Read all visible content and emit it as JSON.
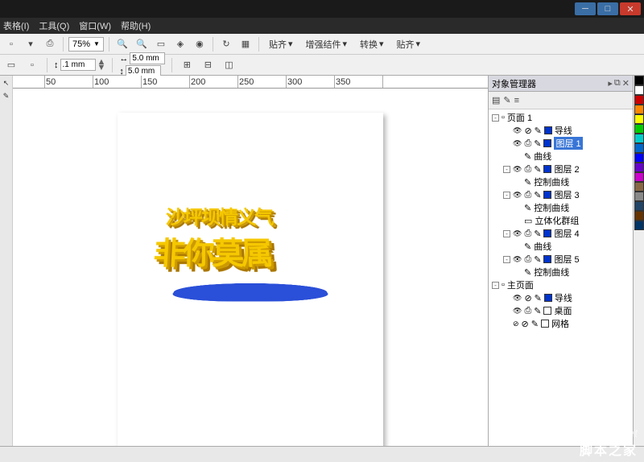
{
  "menubar": [
    "表格(I)",
    "工具(Q)",
    "窗口(W)",
    "帮助(H)"
  ],
  "toolbar1": {
    "zoom": "75%",
    "actions": [
      "贴齐",
      "增强结件",
      "转换",
      "贴齐"
    ]
  },
  "toolbar2": {
    "nudge": ".1 mm",
    "w": "5.0 mm",
    "h": "5.0 mm"
  },
  "ruler_ticks": [
    "50",
    "100",
    "150",
    "200",
    "250",
    "300",
    "350"
  ],
  "artwork": {
    "line1": "沙坪坝情义气",
    "line2": "非你莫属"
  },
  "panel": {
    "title": "对象管理器",
    "tree": [
      {
        "lvl": 1,
        "exp": "-",
        "label": "页面 1",
        "icon": "page"
      },
      {
        "lvl": 2,
        "exp": "",
        "label": "导线",
        "vis": true,
        "prn": false,
        "sw": "blue"
      },
      {
        "lvl": 2,
        "exp": "",
        "label": "图层 1",
        "vis": true,
        "prn": true,
        "sw": "blue",
        "sel": true
      },
      {
        "lvl": 3,
        "exp": "",
        "label": "曲线",
        "icon": "curve"
      },
      {
        "lvl": 2,
        "exp": "-",
        "label": "图层 2",
        "vis": true,
        "prn": true,
        "sw": "blue"
      },
      {
        "lvl": 3,
        "exp": "",
        "label": "控制曲线",
        "icon": "curve"
      },
      {
        "lvl": 2,
        "exp": "-",
        "label": "图层 3",
        "vis": true,
        "prn": true,
        "sw": "blue"
      },
      {
        "lvl": 3,
        "exp": "",
        "label": "控制曲线",
        "icon": "curve"
      },
      {
        "lvl": 3,
        "exp": "",
        "label": "立体化群组",
        "icon": "group"
      },
      {
        "lvl": 2,
        "exp": "-",
        "label": "图层 4",
        "vis": true,
        "prn": true,
        "sw": "blue"
      },
      {
        "lvl": 3,
        "exp": "",
        "label": "曲线",
        "icon": "curve"
      },
      {
        "lvl": 2,
        "exp": "-",
        "label": "图层 5",
        "vis": true,
        "prn": true,
        "sw": "blue"
      },
      {
        "lvl": 3,
        "exp": "",
        "label": "控制曲线",
        "icon": "curve"
      },
      {
        "lvl": 1,
        "exp": "-",
        "label": "主页面",
        "icon": "page"
      },
      {
        "lvl": 2,
        "exp": "",
        "label": "导线",
        "vis": true,
        "prn": false,
        "sw": "blue"
      },
      {
        "lvl": 2,
        "exp": "",
        "label": "桌面",
        "vis": true,
        "prn": true,
        "sw": "white"
      },
      {
        "lvl": 2,
        "exp": "",
        "label": "网格",
        "vis": false,
        "prn": false,
        "sw": "white"
      }
    ]
  },
  "colors": [
    "#000",
    "#fff",
    "#c00",
    "#f80",
    "#ff0",
    "#0c0",
    "#0cc",
    "#06c",
    "#00f",
    "#60c",
    "#c0c",
    "#864",
    "#888",
    "#246",
    "#630",
    "#036"
  ],
  "watermark_url": "www.jb51.net",
  "watermark_text": "脚本之家"
}
